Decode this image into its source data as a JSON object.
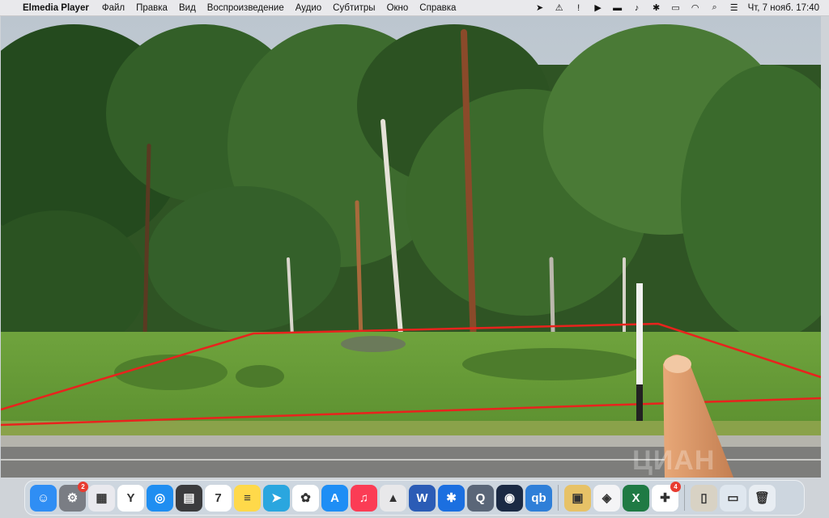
{
  "menubar": {
    "app_name": "Elmedia Player",
    "items": [
      "Файл",
      "Правка",
      "Вид",
      "Воспроизведение",
      "Аудио",
      "Субтитры",
      "Окно",
      "Справка"
    ],
    "status_icons": [
      "telegram-status-icon",
      "warning-icon",
      "info-icon",
      "play-status-icon",
      "flag-icon",
      "volume-icon",
      "bluetooth-icon",
      "battery-icon",
      "wifi-icon",
      "search-icon",
      "control-center-icon"
    ],
    "clock": "Чт, 7 нояб.  17:40"
  },
  "video": {
    "watermark": "ЦИАН"
  },
  "dock": {
    "apps": [
      {
        "name": "finder-icon",
        "glyph": "☺",
        "color": "#2f8ef4"
      },
      {
        "name": "system-preferences-icon",
        "glyph": "⚙",
        "color": "#7a7d84",
        "badge": "2"
      },
      {
        "name": "launchpad-icon",
        "glyph": "▦",
        "color": "#e9e9ee"
      },
      {
        "name": "yandex-browser-icon",
        "glyph": "Y",
        "color": "#ffffff"
      },
      {
        "name": "safari-icon",
        "glyph": "◎",
        "color": "#1f8ef1"
      },
      {
        "name": "calculator-icon",
        "glyph": "▤",
        "color": "#3b3b3d"
      },
      {
        "name": "calendar-icon",
        "glyph": "7",
        "color": "#ffffff"
      },
      {
        "name": "notes-icon",
        "glyph": "≡",
        "color": "#ffd94a"
      },
      {
        "name": "telegram-icon",
        "glyph": "➤",
        "color": "#2aa6df"
      },
      {
        "name": "photos-icon",
        "glyph": "✿",
        "color": "#ffffff"
      },
      {
        "name": "app-store-icon",
        "glyph": "A",
        "color": "#1e8ef5"
      },
      {
        "name": "music-icon",
        "glyph": "♫",
        "color": "#fb3c55"
      },
      {
        "name": "elmedia-player-icon",
        "glyph": "▲",
        "color": "#e8e8ea"
      },
      {
        "name": "word-icon",
        "glyph": "W",
        "color": "#2b5cb6"
      },
      {
        "name": "bluetooth-app-icon",
        "glyph": "✱",
        "color": "#1b6fe0"
      },
      {
        "name": "quicktime-icon",
        "glyph": "Q",
        "color": "#5a6678"
      },
      {
        "name": "steam-icon",
        "glyph": "◉",
        "color": "#1b2a44"
      },
      {
        "name": "qbittorrent-icon",
        "glyph": "qb",
        "color": "#2f7fd8"
      },
      {
        "name": "archive-icon",
        "glyph": "▣",
        "color": "#e7c267"
      },
      {
        "name": "virtualbox-icon",
        "glyph": "◈",
        "color": "#f4f4f6"
      },
      {
        "name": "excel-icon",
        "glyph": "X",
        "color": "#1f7a44"
      },
      {
        "name": "office-icon",
        "glyph": "✚",
        "color": "#ffffff",
        "badge": "4"
      }
    ],
    "trailing": [
      {
        "name": "document-icon",
        "glyph": "▯",
        "color": "#d8d2c4"
      },
      {
        "name": "preview-icon",
        "glyph": "▭",
        "color": "#dfe7ef"
      },
      {
        "name": "trash-icon",
        "glyph": "🗑",
        "color": "#e8edf2"
      }
    ]
  }
}
